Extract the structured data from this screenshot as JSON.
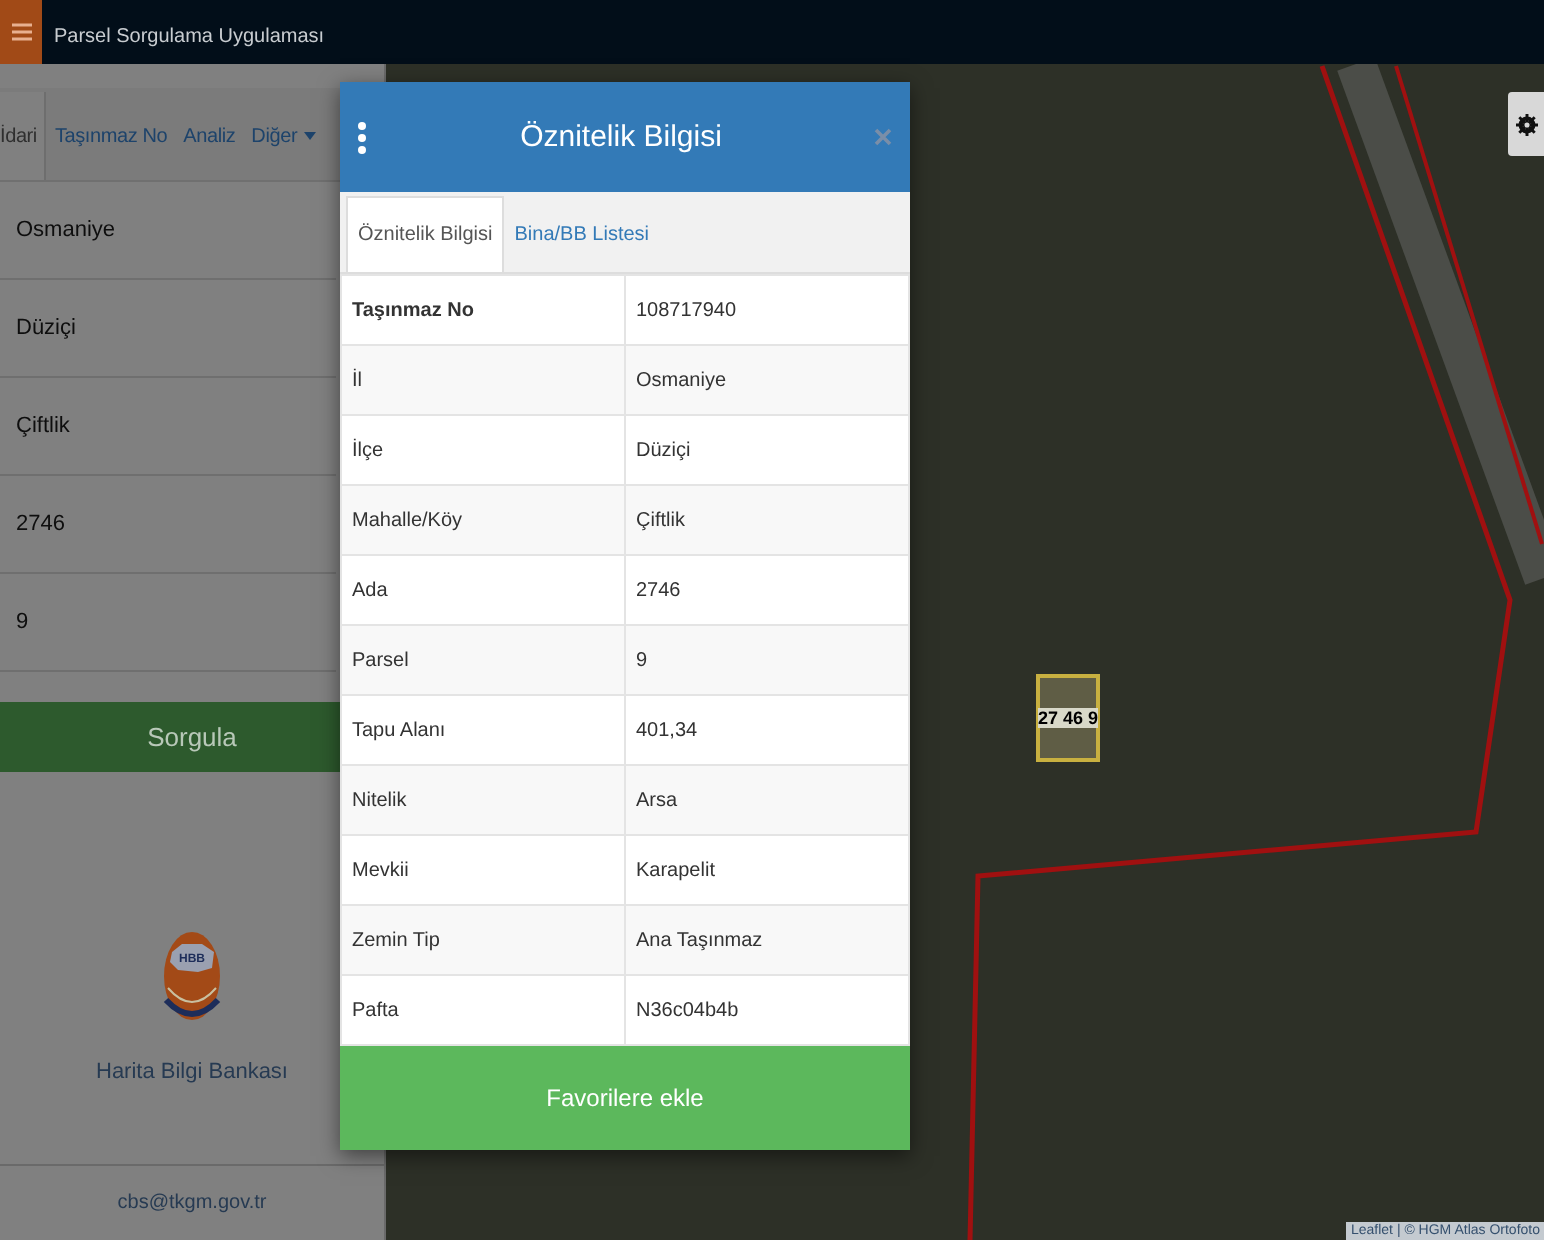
{
  "header": {
    "subtitle": "Parsel Sorgulama Uygulaması"
  },
  "sidebar": {
    "tabs": [
      {
        "label": "İdari",
        "selected": true,
        "kind": "plain"
      },
      {
        "label": "Taşınmaz No",
        "selected": false,
        "kind": "plain"
      },
      {
        "label": "Analiz",
        "selected": false,
        "kind": "plain"
      },
      {
        "label": "Diğer",
        "selected": false,
        "kind": "dropdown"
      }
    ],
    "fields": [
      {
        "value": "Osmaniye"
      },
      {
        "value": "Düziçi"
      },
      {
        "value": "Çiftlik"
      },
      {
        "value": "2746"
      },
      {
        "value": "9"
      }
    ],
    "query_button": "Sorgula",
    "logo_text": "HBB",
    "logo_caption": "Harita Bilgi Bankası",
    "email": "cbs@tkgm.gov.tr"
  },
  "map": {
    "parcel_label": "27 46 9",
    "attribution": "Leaflet | © HGM Atlas Ortofoto"
  },
  "dialog": {
    "title": "Öznitelik Bilgisi",
    "tabs": [
      {
        "label": "Öznitelik Bilgisi",
        "selected": true
      },
      {
        "label": "Bina/BB Listesi",
        "selected": false
      }
    ],
    "rows": [
      {
        "key": "Taşınmaz No",
        "value": "108717940"
      },
      {
        "key": "İl",
        "value": "Osmaniye"
      },
      {
        "key": "İlçe",
        "value": "Düziçi"
      },
      {
        "key": "Mahalle/Köy",
        "value": "Çiftlik"
      },
      {
        "key": "Ada",
        "value": "2746"
      },
      {
        "key": "Parsel",
        "value": "9"
      },
      {
        "key": "Tapu Alanı",
        "value": "401,34"
      },
      {
        "key": "Nitelik",
        "value": "Arsa"
      },
      {
        "key": "Mevkii",
        "value": "Karapelit"
      },
      {
        "key": "Zemin Tip",
        "value": "Ana Taşınmaz"
      },
      {
        "key": "Pafta",
        "value": "N36c04b4b"
      }
    ],
    "button": "Favorilere ekle"
  }
}
